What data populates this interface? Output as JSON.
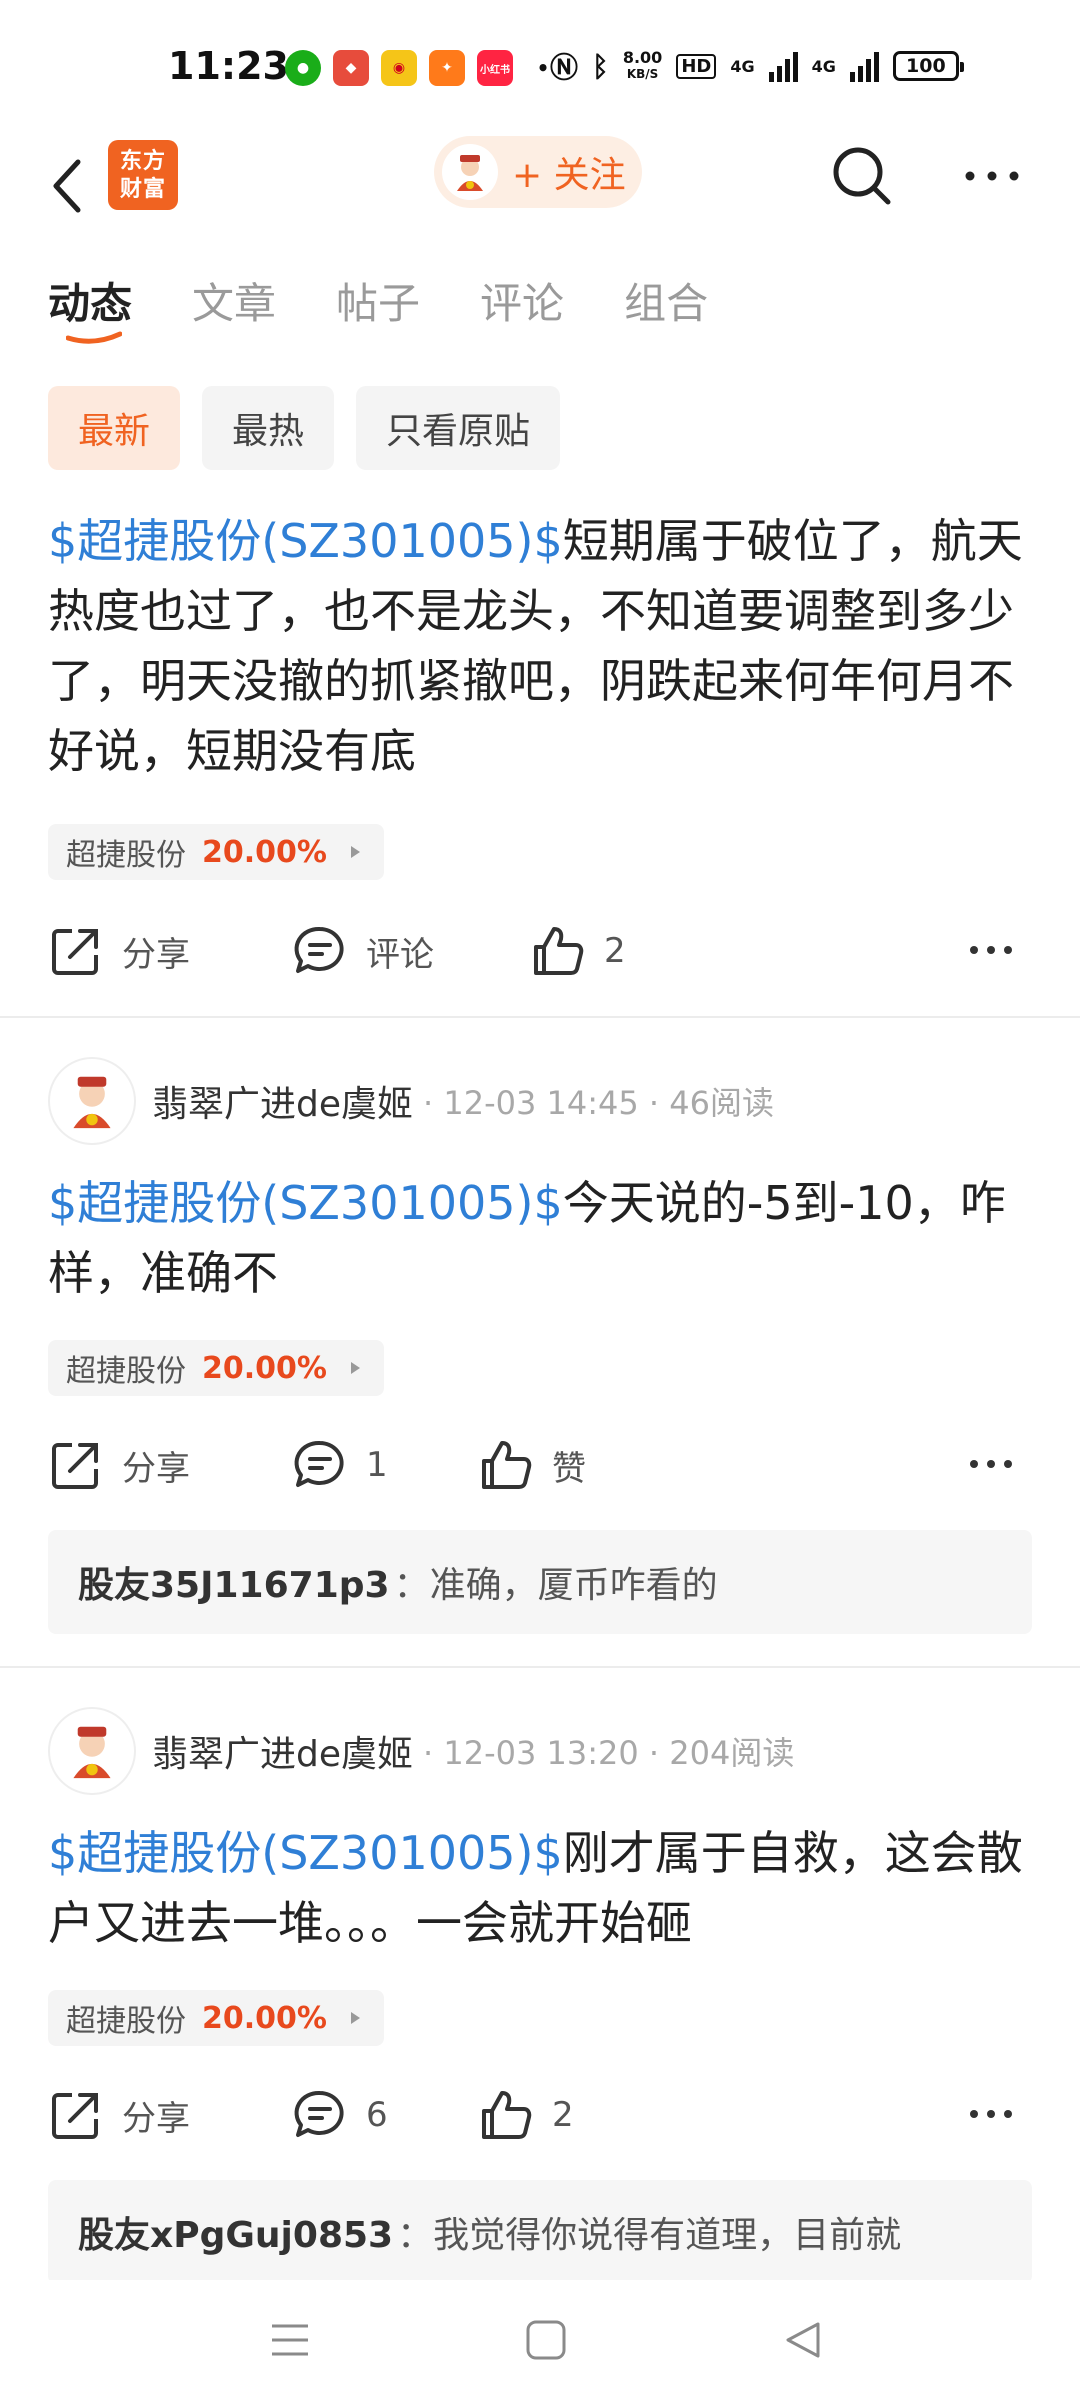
{
  "status_bar": {
    "time": "11:23",
    "speed_top": "8.00",
    "speed_bottom": "KB/S",
    "hd": "HD",
    "net1": "4G",
    "net2": "4G",
    "battery": "100",
    "app_badge": "小红书"
  },
  "header": {
    "logo_line1": "东方",
    "logo_line2": "财富",
    "follow_label": "+ 关注"
  },
  "tabs": [
    "动态",
    "文章",
    "帖子",
    "评论",
    "组合"
  ],
  "filters": [
    "最新",
    "最热",
    "只看原贴"
  ],
  "posts": [
    {
      "stock_link": "$超捷股份(SZ301005)$",
      "text": "短期属于破位了，航天热度也过了，也不是龙头，不知道要调整到多少了，明天没撤的抓紧撤吧，阴跌起来何年何月不好说，短期没有底",
      "tag_name": "超捷股份",
      "tag_pct": "20.00%",
      "share": "分享",
      "comment": "评论",
      "likes": "2"
    },
    {
      "author": "翡翠广进de虞姬",
      "meta": "· 12-03 14:45 · 46阅读",
      "stock_link": "$超捷股份(SZ301005)$",
      "text": "今天说的-5到-10，咋样，准确不",
      "tag_name": "超捷股份",
      "tag_pct": "20.00%",
      "share": "分享",
      "comment": "1",
      "likes": "赞",
      "reply_user": "股友35J11671p3",
      "reply_text": "：准确，厦币咋看的"
    },
    {
      "author": "翡翠广进de虞姬",
      "meta": "· 12-03 13:20 · 204阅读",
      "stock_link": "$超捷股份(SZ301005)$",
      "text": "刚才属于自救，这会散户又进去一堆。。。一会就开始砸",
      "tag_name": "超捷股份",
      "tag_pct": "20.00%",
      "share": "分享",
      "comment": "6",
      "likes": "2",
      "reply_user": "股友xPgGuj0853",
      "reply_text": "：我觉得你说得有道理，目前就"
    }
  ],
  "colors": {
    "accent": "#f06321",
    "stock_link": "#2f7fd6",
    "pct_red": "#e8491d"
  }
}
